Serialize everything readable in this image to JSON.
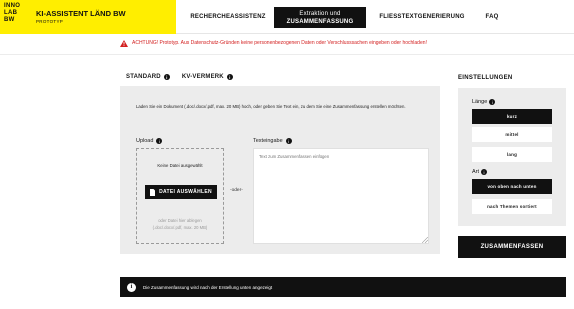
{
  "brand": {
    "logo_lines": [
      "INNO",
      "LAB",
      "BW"
    ],
    "title": "KI-ASSISTENT LÄND BW",
    "subtitle": "PROTOTYP",
    "color": "#ffee00"
  },
  "nav": {
    "items": [
      {
        "label": "RECHERCHEASSISTENZ"
      },
      {
        "label_line1": "Extraktion und",
        "label_line2": "ZUSAMMENFASSUNG"
      },
      {
        "label": "FLIESSTEXTGENERIERUNG"
      },
      {
        "label": "FAQ"
      }
    ],
    "active_index": 1
  },
  "warning": {
    "text": "ACHTUNG! Prototyp. Aus Datenschutz-Gründen keine personenbezogenen Daten oder Verschlusssachen eingeben oder hochladen!",
    "color": "#d32020",
    "icon": "warning-triangle-icon"
  },
  "tabs": [
    {
      "label": "STANDARD",
      "active": true
    },
    {
      "label": "KV-VERMERK",
      "active": false
    }
  ],
  "main": {
    "intro": "Laden Sie ein Dokument (.doc/.docx/.pdf, max. 20 MB) hoch, oder geben Sie Text ein, zu dem Sie eine Zusammenfassung erstellen möchten.",
    "upload_label": "Upload",
    "no_file": "Keine Datei ausgewählt",
    "choose_button": "DATEI AUSWÄHLEN",
    "drop_hint_line1": "oder Datei hier ablegen",
    "drop_hint_line2": "(.doc/.docx/.pdf, max. 20 MB)",
    "or_separator": "-oder-",
    "text_label": "Texteingabe",
    "text_placeholder": "Text zum Zusammenfassen einfügen"
  },
  "settings": {
    "title": "EINSTELLUNGEN",
    "length_label": "Länge",
    "length_options": [
      "kurz",
      "mittel",
      "lang"
    ],
    "length_selected": 0,
    "type_label": "Art",
    "type_options": [
      "von oben nach unten",
      "nach Themen sortiert"
    ],
    "type_selected": 0,
    "submit_label": "ZUSAMMENFASSEN"
  },
  "info_bar": {
    "icon": "info-icon",
    "text": "Die Zusammenfassung wird nach der Erstellung unten angezeigt"
  }
}
